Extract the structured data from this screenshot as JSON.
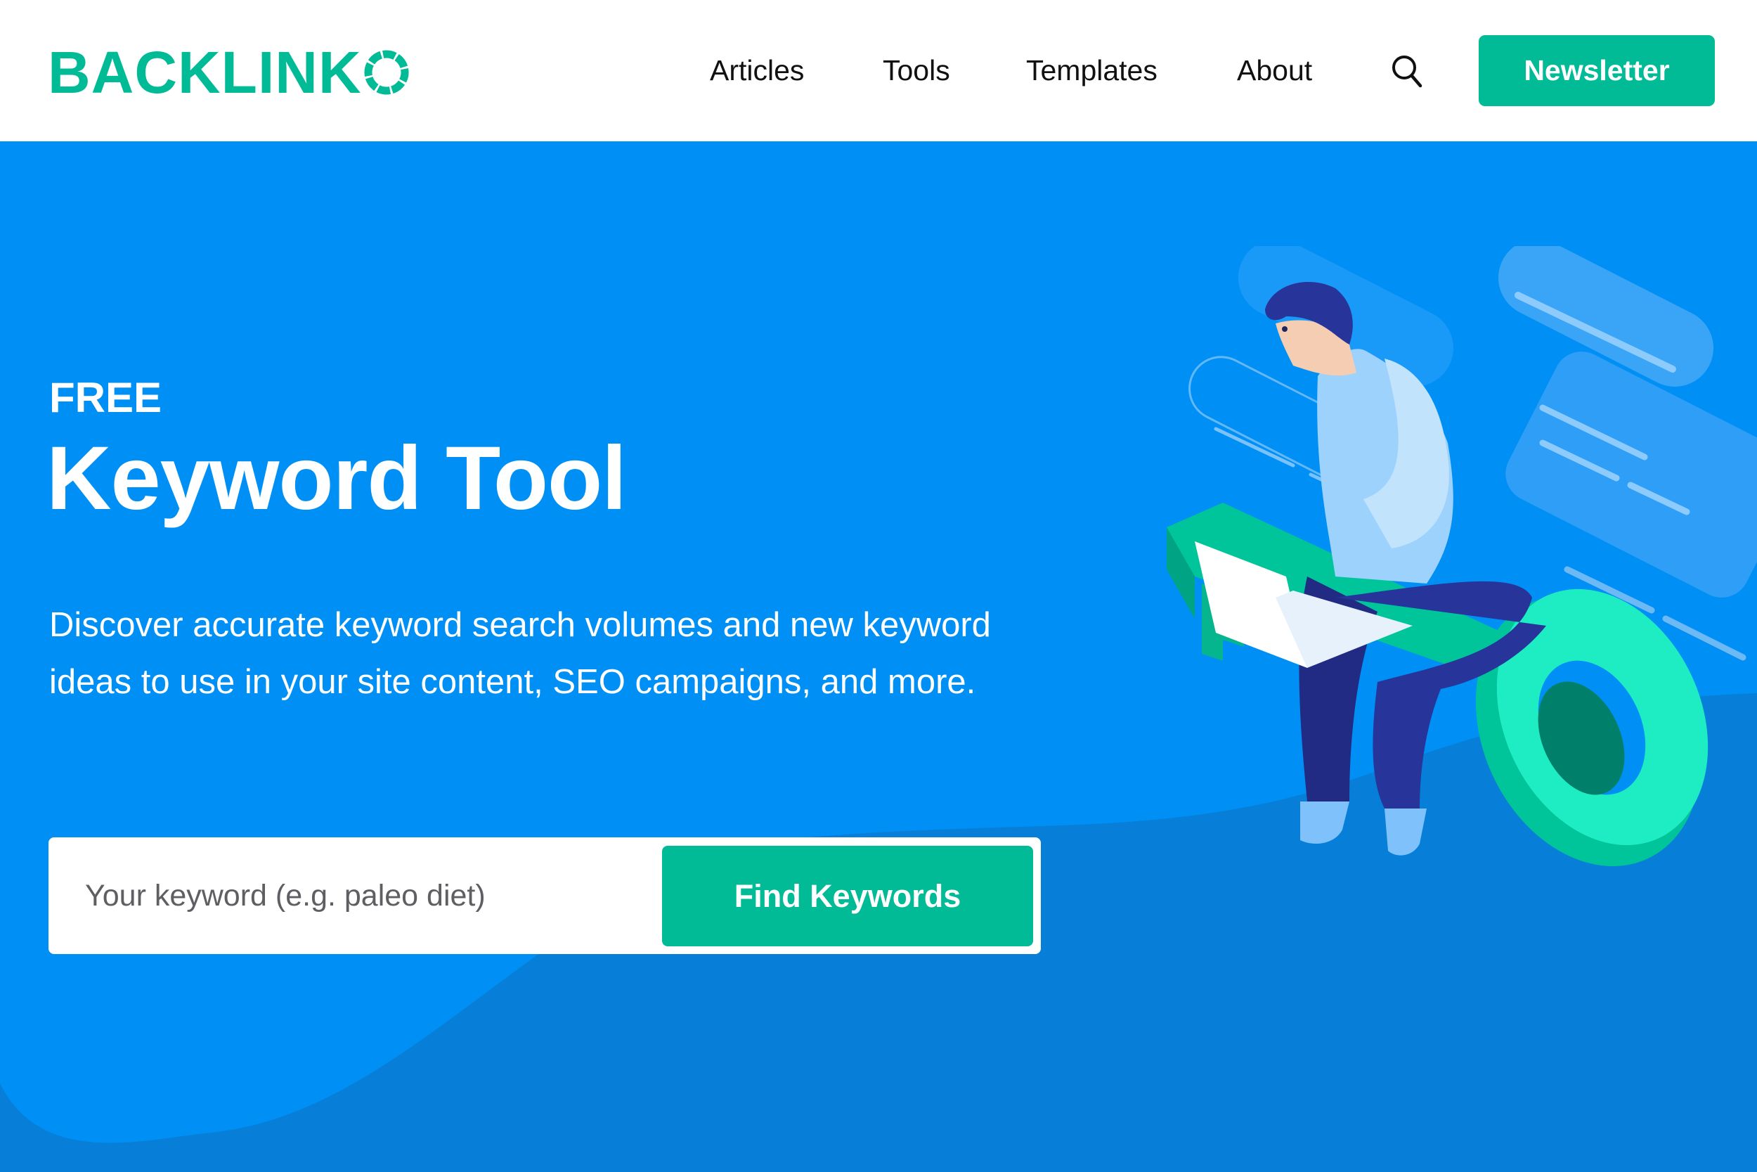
{
  "header": {
    "logo_text": "BACKLINK",
    "logo_icon": "ring-o-icon",
    "nav": [
      {
        "label": "Articles"
      },
      {
        "label": "Tools"
      },
      {
        "label": "Templates"
      },
      {
        "label": "About"
      }
    ],
    "search_icon": "search-icon",
    "newsletter_label": "Newsletter"
  },
  "hero": {
    "eyebrow": "FREE",
    "title": "Keyword Tool",
    "description": "Discover accurate keyword search volumes and new keyword ideas to use in your site content, SEO campaigns, and more.",
    "search": {
      "placeholder": "Your keyword (e.g. paleo diet)",
      "value": "",
      "button_label": "Find Keywords"
    },
    "illustration": "person-with-laptop-sitting-on-key"
  },
  "colors": {
    "brand_green": "#00BB96",
    "hero_blue": "#0090F5",
    "wave_blue": "#077FD8",
    "nav_text": "#111111",
    "placeholder_text": "#5f5f63"
  }
}
